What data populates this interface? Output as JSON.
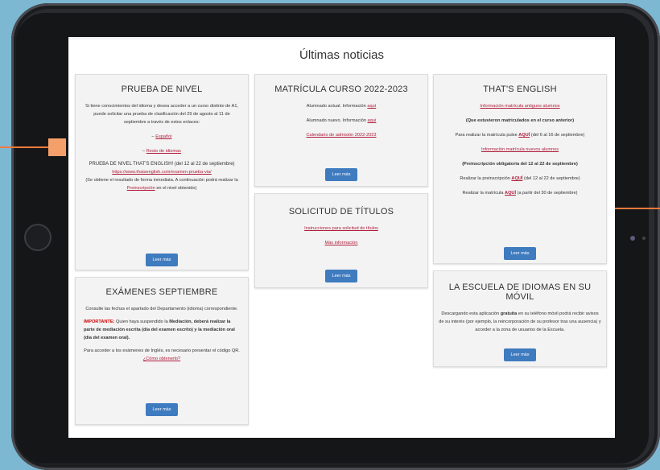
{
  "page": {
    "title": "Últimas noticias"
  },
  "cards": {
    "prueba": {
      "title": "PRUEBA DE NIVEL",
      "p1": "Si tiene conocimientos del idioma y desea acceder a un curso distinto de A1, puede solicitar una prueba de clasificación del 29 de agosto al 11 de septiembre a través de estos enlaces:",
      "link_espanol": "Español",
      "link_resto": "Resto de idiomas",
      "p_ts": "PRUEBA DE NIVEL THAT'S ENGLISH!",
      "p_ts_dates": "(del 12 al 22 de septiembre)",
      "link_url": "https://www.thatsenglish.com/examen-prueba-via/",
      "p_result": "(Se obtiene el resultado de forma inmediata. A continuación podrá realizar la",
      "link_preinscripcion": "Preinscripción",
      "p_result_end": "en el nivel obtenido)",
      "button": "Leer más"
    },
    "matricula": {
      "title": "MATRÍCULA CURSO 2022-2023",
      "p_actual": "Alumnado actual. Información",
      "p_nuevo": "Alumnado nuevo. Información",
      "link_aqui": "aquí",
      "link_calendario": "Calendario de admisión 2022-2023",
      "button": "Leer más"
    },
    "solicitud": {
      "title": "SOLICITUD DE TÍTULOS",
      "link_instrucciones": "Instrucciones para solicitud de títulos",
      "link_mas": "Más información",
      "button": "Leer más"
    },
    "thats": {
      "title": "THAT'S ENGLISH",
      "link_antiguos": "Información matrícula antiguos alumnos",
      "p_estuvieron": "(Que estuvieron matriculados en el curso anterior)",
      "p_pulse": "Para realizar la matrícula pulse",
      "link_aqui": "AQUÍ",
      "p_pulse_dates": "(del 6 al 16 de septiembre)",
      "link_nuevos": "Información matrícula nuevos alumnos",
      "p_preinsc": "(Preinscripción obligatoria del 12 al 22 de septiembre)",
      "p_realizar_pre": "Realizar la preinscripción",
      "p_realizar_pre_dates": "(del 12 al 22 de septiembre)",
      "p_realizar_mat": "Realizar la matrícula",
      "p_realizar_mat_dates": "(a partir del 30 de septiembre)",
      "button": "Leer más"
    },
    "escuela": {
      "title": "LA ESCUELA DE IDIOMAS EN SU MÓVIL",
      "p1": "Descargando esta aplicación",
      "p1_bold": "gratuita",
      "p1_rest": "en su teléfono móvil podrá recibir avisos de su interés (por ejemplo, la reincorporación de su profesor tras una ausencia) y acceder a la zona de usuarios de la Escuela.",
      "button": "Leer más"
    },
    "examenes": {
      "title": "EXÁMENES SEPTIEMBRE",
      "p1": "Consulte las fechas el apartado del Departamento (idioma) correspondiente.",
      "importante": "IMPORTANTE:",
      "p2a": "Quien haya suspendido la",
      "p2b": "Mediación, deberá realizar la parte de mediación escrita (día del examen escrito) y la mediación oral (día del examen oral).",
      "p3": "Para acceder a los exámenes de Inglés, es necesario presentar el código QR.",
      "link_como": "¿Cómo obtenerlo?",
      "button": "Leer más"
    }
  },
  "colors": {
    "accent": "#3f7bbf",
    "link": "#b01d3b",
    "annotation": "#f07a3c"
  }
}
